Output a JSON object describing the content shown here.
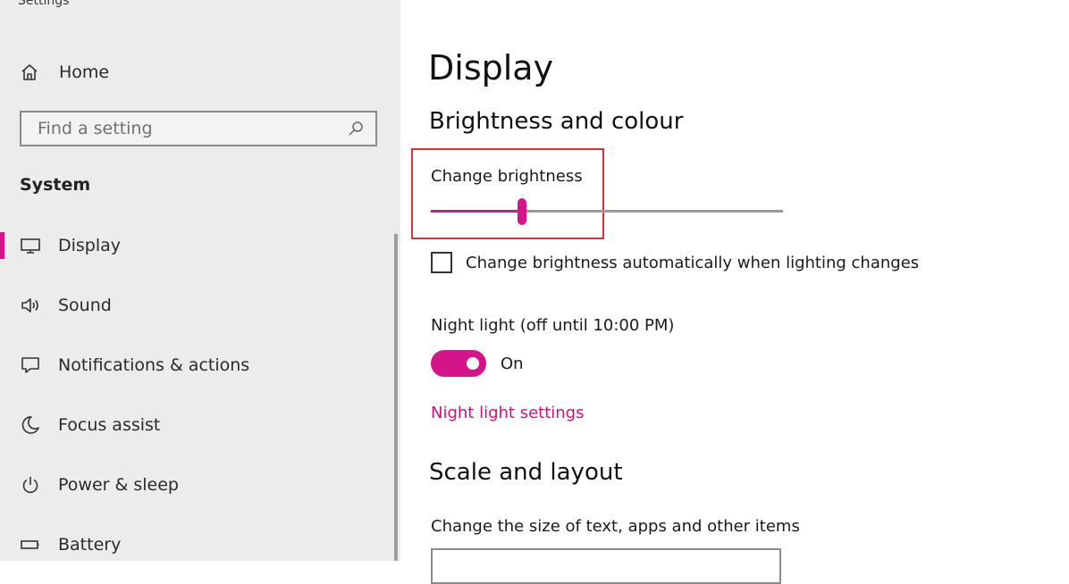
{
  "window": {
    "title": "Settings"
  },
  "sidebar": {
    "home": {
      "label": "Home",
      "icon": "home-icon"
    },
    "search": {
      "placeholder": "Find a setting",
      "icon": "search-icon"
    },
    "section": "System",
    "items": [
      {
        "label": "Display",
        "icon": "monitor-icon",
        "active": true
      },
      {
        "label": "Sound",
        "icon": "speaker-icon"
      },
      {
        "label": "Notifications & actions",
        "icon": "notification-icon"
      },
      {
        "label": "Focus assist",
        "icon": "moon-icon"
      },
      {
        "label": "Power & sleep",
        "icon": "power-icon"
      },
      {
        "label": "Battery",
        "icon": "battery-icon"
      }
    ]
  },
  "main": {
    "title": "Display",
    "brightness_section": {
      "heading": "Brightness and colour",
      "slider_label": "Change brightness",
      "brightness_value_fraction": 0.26,
      "auto_checkbox_label": "Change brightness automatically when lighting changes",
      "auto_checked": false
    },
    "night_light": {
      "label": "Night light (off until 10:00 PM)",
      "toggle_state": "On",
      "enabled": true,
      "settings_link": "Night light settings"
    },
    "scale_section": {
      "heading": "Scale and layout",
      "size_label": "Change the size of text, apps and other items"
    }
  },
  "colors": {
    "accent": "#d4158a",
    "highlight_border": "#d9313b",
    "sidebar_bg": "#ececec"
  }
}
